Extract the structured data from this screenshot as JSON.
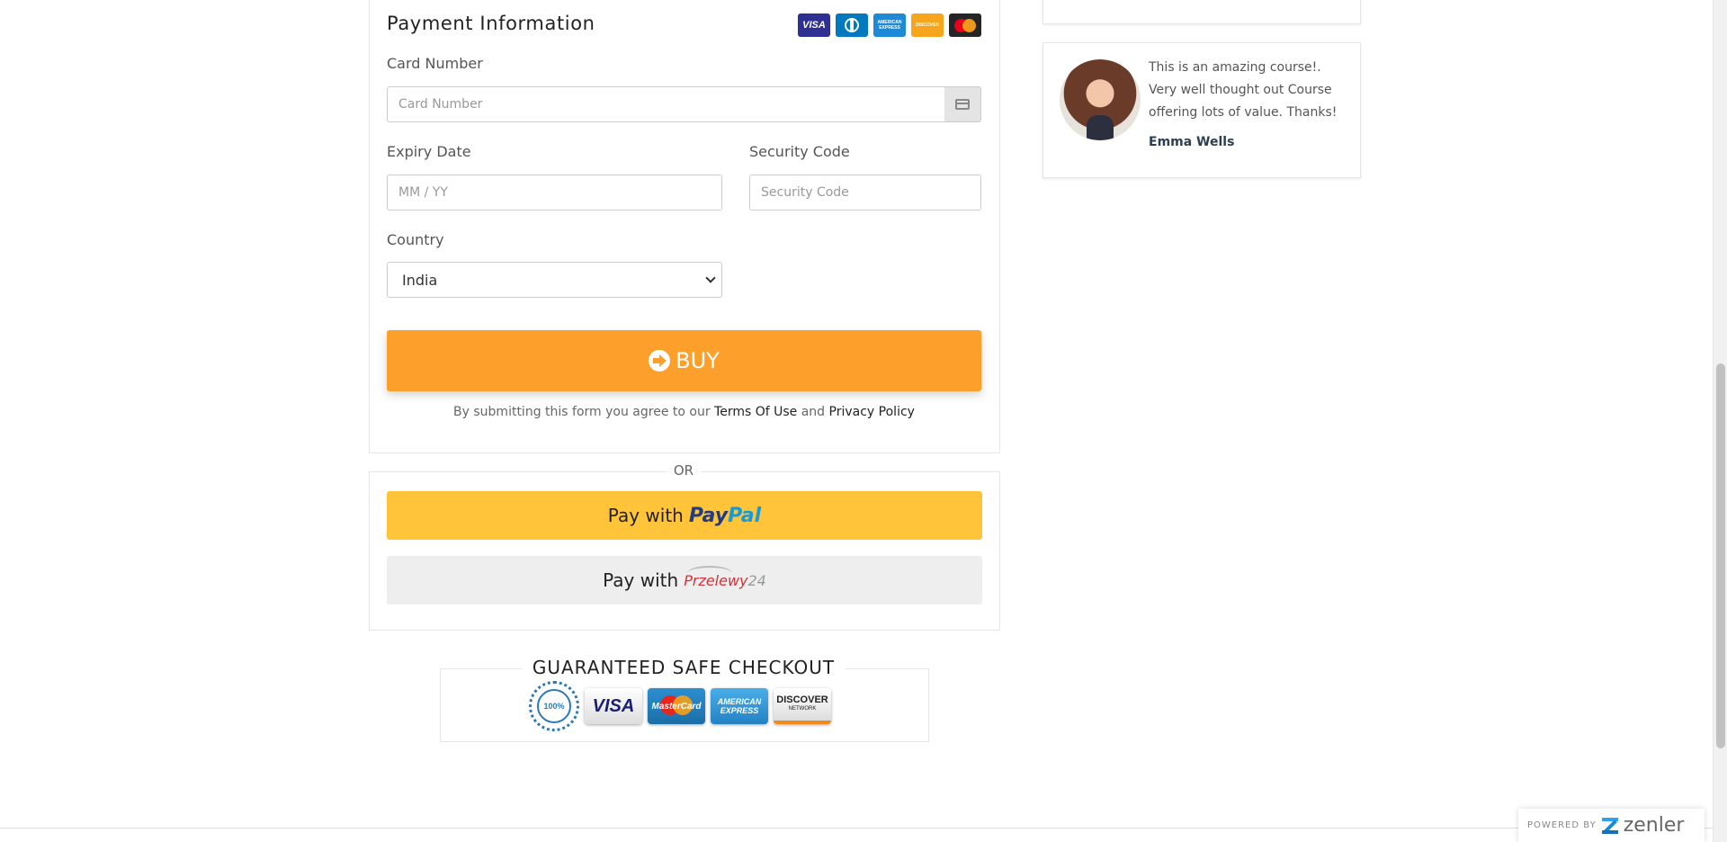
{
  "payment": {
    "title": "Payment Information",
    "card_logos": [
      "visa",
      "diners",
      "amex",
      "discover",
      "mastercard"
    ],
    "card_logo_text": {
      "visa": "VISA",
      "amex": "AMERICAN EXPRESS",
      "discover": "DISCOVER"
    },
    "card_number_label": "Card Number",
    "card_number_placeholder": "Card Number",
    "expiry_label": "Expiry Date",
    "expiry_placeholder": "MM / YY",
    "security_label": "Security Code",
    "security_placeholder": "Security Code",
    "country_label": "Country",
    "country_value": "India",
    "buy_label": "BUY",
    "terms_prefix": "By submitting this form you agree to our ",
    "terms_link": "Terms Of Use",
    "terms_and": " and ",
    "privacy_link": "Privacy Policy"
  },
  "alt_payment": {
    "or_label": "OR",
    "paypal_prefix": "Pay with",
    "paypal_logo_a": "Pay",
    "paypal_logo_b": "Pal",
    "p24_prefix": "Pay with",
    "p24_logo_a": "Przelewy",
    "p24_logo_b": "24"
  },
  "guarantee": {
    "title": "GUARANTEED SAFE CHECKOUT",
    "seal_text": "100%",
    "badge_visa": "VISA",
    "badge_mc": "MasterCard",
    "badge_amex": "AMERICAN EXPRESS",
    "badge_discover": "DISCOVER",
    "badge_discover_sub": "NETWORK"
  },
  "testimonial": {
    "text": "This is an amazing course!. Very well thought out Course offering lots of value. Thanks!",
    "name": "Emma Wells"
  },
  "footer": {
    "powered_label": "POWERED BY",
    "brand": "zenler"
  },
  "colors": {
    "buy": "#fca02b",
    "paypal": "#ffc439",
    "p24": "#eeeeee"
  }
}
